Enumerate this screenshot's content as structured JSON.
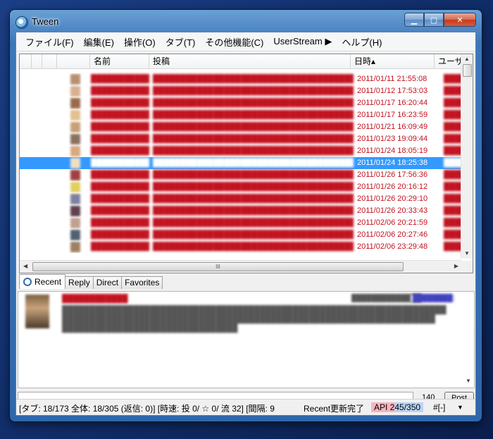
{
  "window": {
    "title": "Tween"
  },
  "menu": [
    "ファイル(F)",
    "編集(E)",
    "操作(O)",
    "タブ(T)",
    "その他機能(C)",
    "UserStream ▶",
    "ヘルプ(H)"
  ],
  "timeline": {
    "columns": [
      "名前",
      "投稿",
      "日時▴",
      "ユーザ"
    ],
    "rows": [
      {
        "date": "2011/01/11 21:55:08"
      },
      {
        "date": "2011/01/12 17:53:03"
      },
      {
        "date": "2011/01/17 16:20:44"
      },
      {
        "date": "2011/01/17 16:23:59"
      },
      {
        "date": "2011/01/21 16:09:49"
      },
      {
        "date": "2011/01/23 19:09:44"
      },
      {
        "date": "2011/01/24 18:05:19"
      },
      {
        "date": "2011/01/24 18:25:38",
        "selected": true
      },
      {
        "date": "2011/01/26 17:56:36"
      },
      {
        "date": "2011/01/26 20:16:12"
      },
      {
        "date": "2011/01/26 20:29:10"
      },
      {
        "date": "2011/01/26 20:33:43"
      },
      {
        "date": "2011/02/06 20:21:59"
      },
      {
        "date": "2011/02/06 20:27:46"
      },
      {
        "date": "2011/02/06 23:29:48"
      }
    ],
    "hscroll_label": "III"
  },
  "tabs": [
    "Recent",
    "Reply",
    "Direct",
    "Favorites"
  ],
  "composer": {
    "remaining": "140",
    "post_label": "Post"
  },
  "statusbar": {
    "stats": "[タブ: 18/173 全体: 18/305 (返信: 0)] [時速: 投 0/ ☆ 0/ 流 32] [間隔: 9",
    "message": "Recent更新完了",
    "api": "API 245/350",
    "menu": "#[-]",
    "menu_arrow": "▼"
  },
  "colors": {
    "accent_selection": "#3399ff",
    "post_text": "#c1121f"
  },
  "icons": [
    "app-globe-icon",
    "minimize-icon",
    "maximize-icon",
    "close-icon",
    "recent-tab-icon"
  ]
}
